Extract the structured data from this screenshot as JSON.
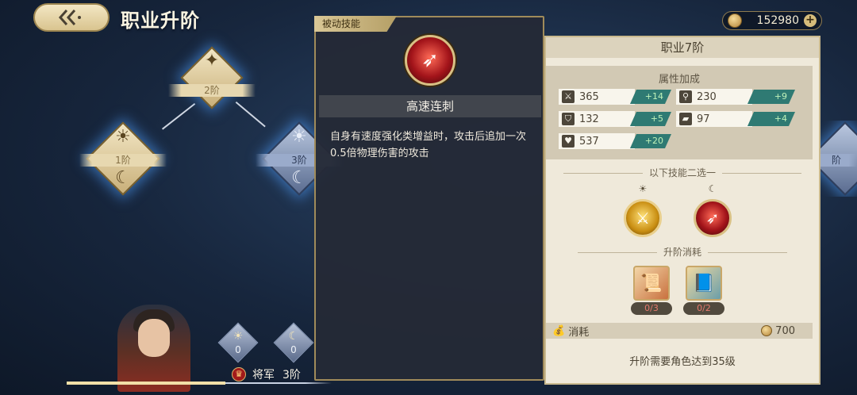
{
  "header": {
    "back_icon": "back-arrow-icon",
    "title": "职业升阶",
    "currency": {
      "icon": "coin-icon",
      "amount": "152980",
      "plus_label": "+"
    }
  },
  "tree": {
    "nodes": [
      {
        "label": "2阶",
        "style": "gold",
        "top_icon": "compass-star-icon"
      },
      {
        "label": "1阶",
        "style": "gold",
        "top_icon": "sun-icon",
        "bottom_icon": "moon-icon"
      },
      {
        "label": "3阶",
        "style": "blue",
        "top_icon": "sun-icon",
        "bottom_icon": "moon-icon"
      },
      {
        "label": "阶",
        "style": "blue"
      }
    ]
  },
  "tooltip": {
    "tag": "被动技能",
    "skill_icon": "red-blade-skill-icon",
    "skill_name": "高速连刺",
    "description": "自身有速度强化类增益时，攻击后追加一次0.5倍物理伤害的攻击"
  },
  "panel": {
    "title": "职业7阶",
    "attr_title": "属性加成",
    "stats": [
      {
        "icon": "sword-icon",
        "value": "365",
        "bonus": "+14"
      },
      {
        "icon": "staff-icon",
        "value": "230",
        "bonus": "+9"
      },
      {
        "icon": "shield-icon",
        "value": "132",
        "bonus": "+5"
      },
      {
        "icon": "book-icon",
        "value": "97",
        "bonus": "+4"
      },
      {
        "icon": "heart-icon",
        "value": "537",
        "bonus": "+20"
      }
    ],
    "choose_label": "以下技能二选一",
    "choices": [
      {
        "name": "sun-skill-option",
        "icon": "gold-blade-skill-icon",
        "symbol": "sun-icon"
      },
      {
        "name": "moon-skill-option",
        "icon": "red-blade-skill-icon",
        "symbol": "moon-icon"
      }
    ],
    "cost_label": "升阶消耗",
    "items": [
      {
        "icon": "red-scroll-item-icon",
        "count": "0/3"
      },
      {
        "icon": "blue-book-item-icon",
        "count": "0/2"
      }
    ],
    "gold_cost": {
      "label": "消耗",
      "amount": "700"
    },
    "requirement": "升阶需要角色达到35级"
  },
  "character": {
    "portrait": "character-portrait",
    "sun_points": "0",
    "moon_points": "0",
    "rank_name": "将军",
    "rank_level": "3阶",
    "progress": 0.6
  },
  "colors": {
    "accent_gold": "#d9c084",
    "bonus_teal": "#2f7a73",
    "panel_bg": "#efe9da"
  }
}
